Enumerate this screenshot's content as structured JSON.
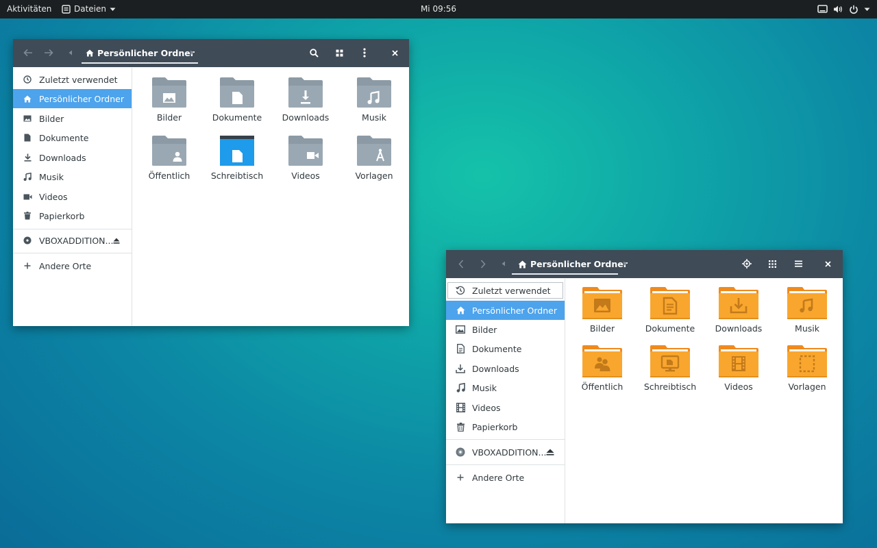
{
  "topbar": {
    "activities": "Aktivitäten",
    "app_menu": "Dateien",
    "clock": "Mi 09:56"
  },
  "windows": [
    {
      "path": "Persönlicher Ordner",
      "sidebar": {
        "items": [
          "Zuletzt verwendet",
          "Persönlicher Ordner",
          "Bilder",
          "Dokumente",
          "Downloads",
          "Musik",
          "Videos",
          "Papierkorb"
        ],
        "device": "VBOXADDITION...",
        "other": "Andere Orte"
      },
      "folders": [
        "Bilder",
        "Dokumente",
        "Downloads",
        "Musik",
        "Öffentlich",
        "Schreibtisch",
        "Videos",
        "Vorlagen"
      ]
    },
    {
      "path": "Persönlicher Ordner",
      "sidebar": {
        "items": [
          "Zuletzt verwendet",
          "Persönlicher Ordner",
          "Bilder",
          "Dokumente",
          "Downloads",
          "Musik",
          "Videos",
          "Papierkorb"
        ],
        "device": "VBOXADDITION...",
        "other": "Andere Orte"
      },
      "folders": [
        "Bilder",
        "Dokumente",
        "Downloads",
        "Musik",
        "Öffentlich",
        "Schreibtisch",
        "Videos",
        "Vorlagen"
      ]
    }
  ],
  "colors": {
    "headerbar": "#3f4b57",
    "sidebar_selected": "#4da3ec",
    "folder_grey": "#8c9aa5",
    "folder_blue": "#1e9bea",
    "folder_orange": "#f9a62e"
  }
}
